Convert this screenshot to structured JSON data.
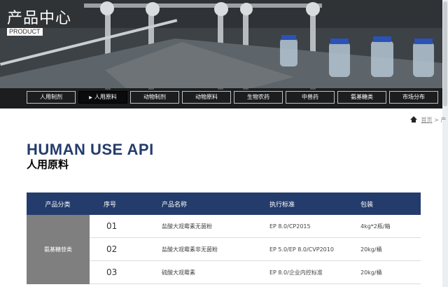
{
  "hero": {
    "title": "产品中心",
    "subtitle": "PRODUCT"
  },
  "tabs": [
    {
      "label": "人用制剂",
      "active": false
    },
    {
      "label": "人用原料",
      "active": true
    },
    {
      "label": "动物制剂",
      "active": false
    },
    {
      "label": "动物原料",
      "active": false
    },
    {
      "label": "生物农药",
      "active": false
    },
    {
      "label": "中兽药",
      "active": false
    },
    {
      "label": "氨基糖类",
      "active": false
    },
    {
      "label": "市场分布",
      "active": false
    }
  ],
  "breadcrumb": {
    "home": "首页",
    "sep": ">",
    "current": "产"
  },
  "page": {
    "title_en": "HUMAN USE API",
    "title_cn": "人用原料"
  },
  "table": {
    "headers": [
      "产品分类",
      "序号",
      "产品名称",
      "执行标准",
      "包装"
    ],
    "category": "氨基糖苷类",
    "rows": [
      {
        "no": "01",
        "name": "盐酸大观霉素无菌粉",
        "standard": "EP 8.0/CP2015",
        "pack": "4kg*2瓶/箱"
      },
      {
        "no": "02",
        "name": "盐酸大观霉素非无菌粉",
        "standard": "EP 5.0/EP 8.0/CVP2010",
        "pack": "20kg/桶"
      },
      {
        "no": "03",
        "name": "硫酸大观霉素",
        "standard": "EP 8.0/企业内控标准",
        "pack": "20kg/桶"
      }
    ]
  },
  "colors": {
    "navy": "#243c6c",
    "category_bg": "#7f7f7f"
  }
}
